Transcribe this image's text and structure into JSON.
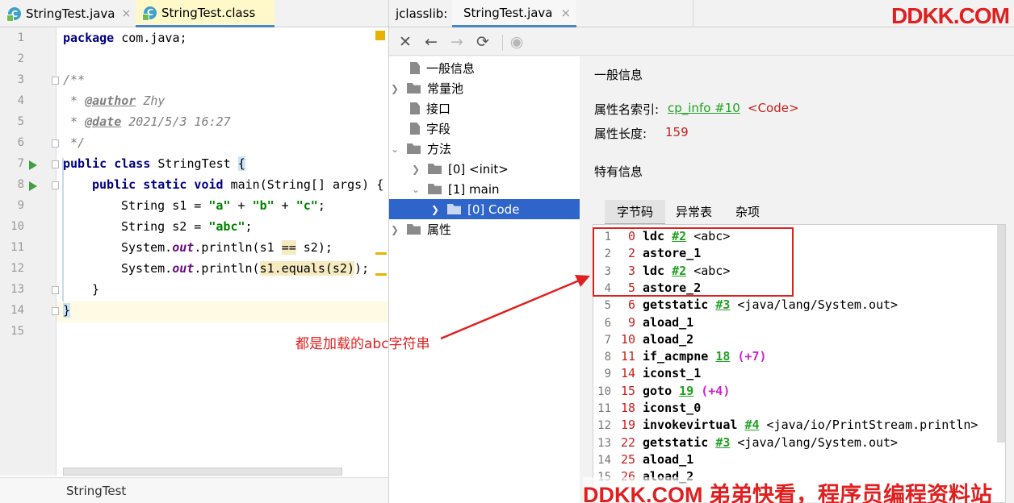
{
  "editor": {
    "tabs": [
      {
        "label": "StringTest.java",
        "close": "×"
      },
      {
        "label": "StringTest.class",
        "close": ""
      }
    ],
    "lines": [
      "1",
      "2",
      "3",
      "4",
      "5",
      "6",
      "7",
      "8",
      "9",
      "10",
      "11",
      "12",
      "13",
      "14",
      "15"
    ],
    "code": {
      "l1_kw": "package",
      "l1_rest": " com.java;",
      "l3": "/**",
      "l4_a": " * ",
      "l4_tag": "@author",
      "l4_b": " Zhy",
      "l5_a": " * ",
      "l5_tag": "@date",
      "l5_b": " 2021/5/3 16:27",
      "l6": " */",
      "l7_kw": "public class",
      "l7_rest": " StringTest ",
      "l7_brace": "{",
      "l8_kw": "public static void",
      "l8_rest": " main(String[] args) {",
      "l9_a": "String s1 = ",
      "l9_s1": "\"a\"",
      "l9_b": " + ",
      "l9_s2": "\"b\"",
      "l9_c": " + ",
      "l9_s3": "\"c\"",
      "l9_d": ";",
      "l10_a": "String s2 = ",
      "l10_s": "\"abc\"",
      "l10_b": ";",
      "l11_a": "System.",
      "l11_f": "out",
      "l11_b": ".println(s1 ",
      "l11_hl": "==",
      "l11_c": " s2);",
      "l12_a": "System.",
      "l12_f": "out",
      "l12_b": ".println(",
      "l12_hl": "s1.equals(s2)",
      "l12_c": ");",
      "l13": "}",
      "l14": "}"
    },
    "status": "StringTest"
  },
  "jclasslib": {
    "label": "jclasslib:",
    "tab": "StringTest.java",
    "tab_close": "×",
    "toolbar": {
      "close": "✕",
      "back": "←",
      "forward": "→",
      "refresh": "⟳",
      "web": "◉"
    },
    "tree": {
      "general": "一般信息",
      "constant_pool": "常量池",
      "interfaces": "接口",
      "fields": "字段",
      "methods": "方法",
      "init": "[0] <init>",
      "main": "[1] main",
      "code": "[0] Code",
      "attributes": "属性"
    },
    "detail": {
      "general_title": "一般信息",
      "attr_name_label": "属性名索引:",
      "attr_name_link": "cp_info #10",
      "attr_name_value": "<Code>",
      "attr_len_label": "属性长度:",
      "attr_len_value": "159",
      "specific_title": "特有信息",
      "subtabs": [
        "字节码",
        "异常表",
        "杂项"
      ]
    },
    "bytecode": [
      {
        "n": "1",
        "off": "0",
        "op": "ldc",
        "ref": "#2",
        "arg": " <abc>"
      },
      {
        "n": "2",
        "off": "2",
        "op": "astore_1",
        "ref": "",
        "arg": ""
      },
      {
        "n": "3",
        "off": "3",
        "op": "ldc",
        "ref": "#2",
        "arg": " <abc>"
      },
      {
        "n": "4",
        "off": "5",
        "op": "astore_2",
        "ref": "",
        "arg": ""
      },
      {
        "n": "5",
        "off": "6",
        "op": "getstatic",
        "ref": "#3",
        "arg": " <java/lang/System.out>"
      },
      {
        "n": "6",
        "off": "9",
        "op": "aload_1",
        "ref": "",
        "arg": ""
      },
      {
        "n": "7",
        "off": "10",
        "op": "aload_2",
        "ref": "",
        "arg": ""
      },
      {
        "n": "8",
        "off": "11",
        "op": "if_acmpne",
        "ref": "18",
        "arg": "",
        "rel": "(+7)"
      },
      {
        "n": "9",
        "off": "14",
        "op": "iconst_1",
        "ref": "",
        "arg": ""
      },
      {
        "n": "10",
        "off": "15",
        "op": "goto",
        "ref": "19",
        "arg": "",
        "rel": "(+4)"
      },
      {
        "n": "11",
        "off": "18",
        "op": "iconst_0",
        "ref": "",
        "arg": ""
      },
      {
        "n": "12",
        "off": "19",
        "op": "invokevirtual",
        "ref": "#4",
        "arg": " <java/io/PrintStream.println>"
      },
      {
        "n": "13",
        "off": "22",
        "op": "getstatic",
        "ref": "#3",
        "arg": " <java/lang/System.out>"
      },
      {
        "n": "14",
        "off": "25",
        "op": "aload_1",
        "ref": "",
        "arg": ""
      },
      {
        "n": "15",
        "off": "26",
        "op": "aload_2",
        "ref": "",
        "arg": ""
      }
    ]
  },
  "annotation": "都是加载的abc字符串",
  "watermark": {
    "top": "DDKK.COM",
    "bottom": "DDKK.COM 弟弟快看，程序员编程资料站"
  },
  "colors": {
    "accent": "#4a86c7",
    "selection": "#2f65ca",
    "annotation": "#e02020",
    "link": "#21a121"
  }
}
